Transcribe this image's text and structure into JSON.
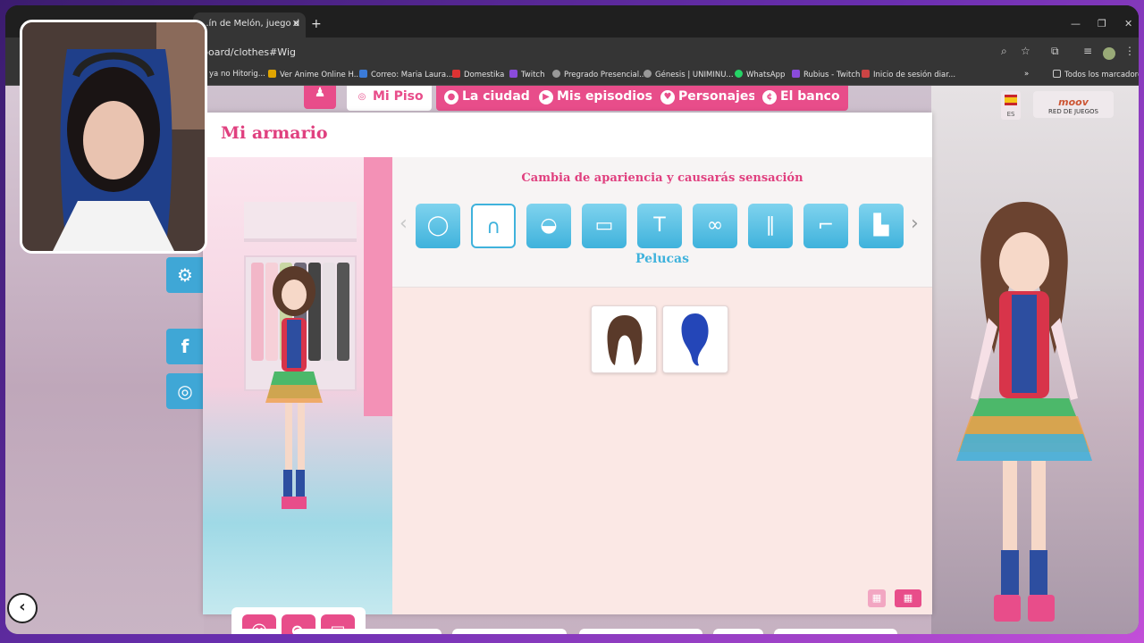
{
  "browser": {
    "tab_title": "...ín de Melón, juego d",
    "url": "board/clothes#Wig",
    "bookmarks": [
      "ya no Hitorig...",
      "Ver Anime Online H...",
      "Correo: Maria Laura...",
      "Domestika",
      "Twitch",
      "Pregrado Presencial...",
      "Génesis | UNIMINU...",
      "WhatsApp",
      "Rubius - Twitch",
      "Inicio de sesión diar...",
      "Todos los marcadores"
    ]
  },
  "game": {
    "nav": [
      "Mi Piso",
      "La ciudad",
      "Mis episodios",
      "Personajes",
      "El banco"
    ],
    "lang": "ES",
    "logo_top": "moov",
    "logo_bottom": "RED DE JUEGOS",
    "panel_title": "Mi armario",
    "subtitle": "Cambia de apariencia y causarás sensación",
    "category_label": "Pelucas",
    "categories": [
      {
        "name": "ring",
        "glyph": "◯"
      },
      {
        "name": "wig",
        "glyph": "∩"
      },
      {
        "name": "hat",
        "glyph": "◒"
      },
      {
        "name": "jacket",
        "glyph": "▭"
      },
      {
        "name": "shirt",
        "glyph": "T"
      },
      {
        "name": "bra",
        "glyph": "∞"
      },
      {
        "name": "pants",
        "glyph": "∥"
      },
      {
        "name": "socks",
        "glyph": "⌐"
      },
      {
        "name": "boots",
        "glyph": "▙"
      }
    ],
    "items": [
      "brown-wig",
      "blue-wig"
    ],
    "social": [
      "f",
      "◎"
    ]
  },
  "colors": {
    "pink": "#e84d8a",
    "blue": "#3fb2dc"
  }
}
